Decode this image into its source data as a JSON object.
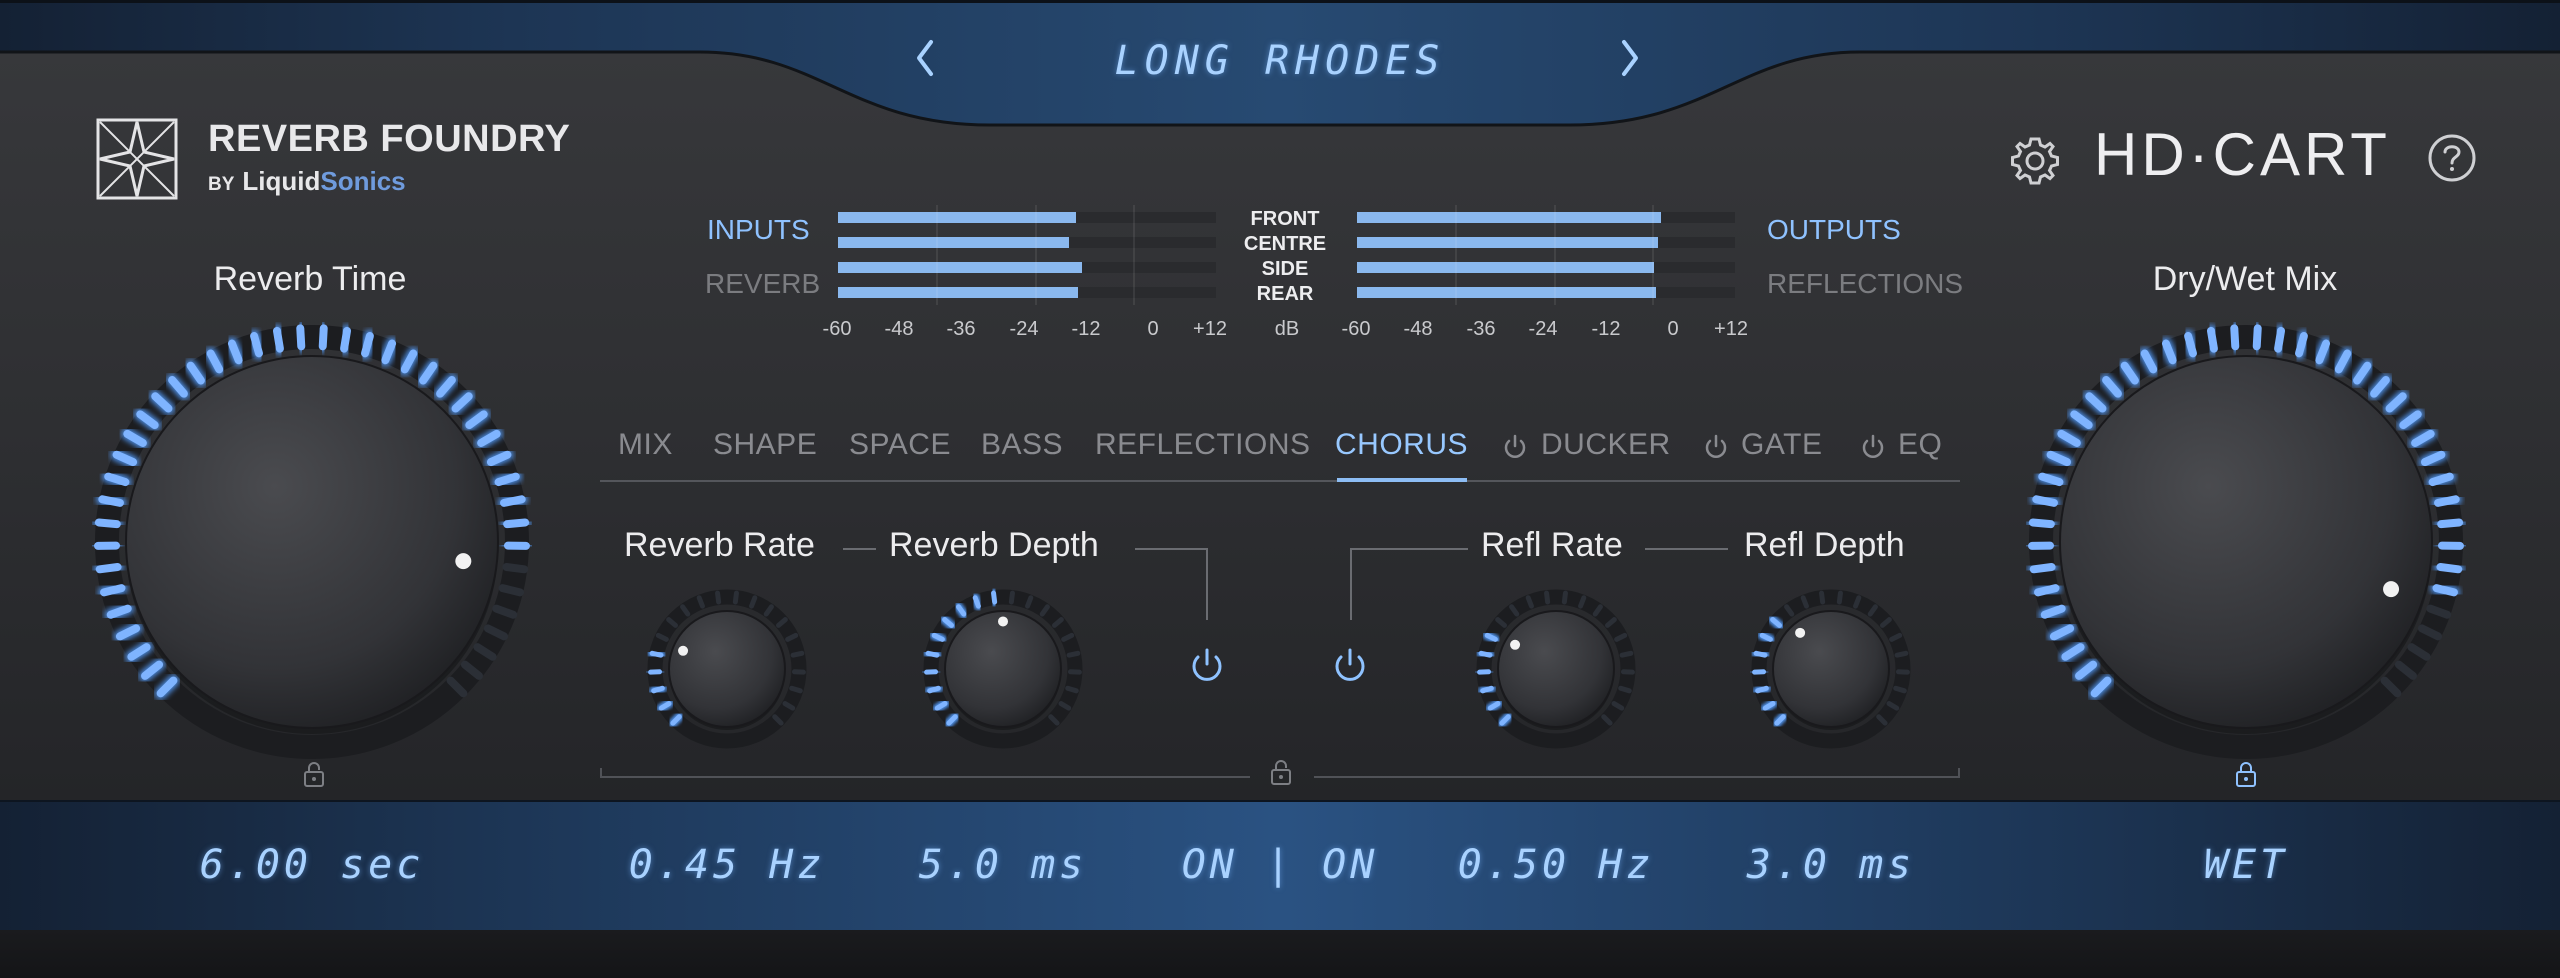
{
  "preset": {
    "name": "LONG RHODES"
  },
  "brand": {
    "title": "REVERB FOUNDRY",
    "by": "BY",
    "liquid": "Liquid",
    "sonics": "Sonics"
  },
  "product": {
    "name": "HD·CART"
  },
  "knobs": {
    "reverb_time": {
      "label": "Reverb Time",
      "value": 0.86
    },
    "dry_wet": {
      "label": "Dry/Wet Mix",
      "value": 0.9
    },
    "reverb_rate": {
      "label": "Reverb Rate",
      "value": 0.25
    },
    "reverb_depth": {
      "label": "Reverb Depth",
      "value": 0.5
    },
    "refl_rate": {
      "label": "Refl Rate",
      "value": 0.28
    },
    "refl_depth": {
      "label": "Refl Depth",
      "value": 0.35
    }
  },
  "meters": {
    "inputs_label": "INPUTS",
    "reverb_label": "REVERB",
    "outputs_label": "OUTPUTS",
    "reflections_label": "REFLECTIONS",
    "channels": [
      "FRONT",
      "CENTRE",
      "SIDE",
      "REAR"
    ],
    "scale": [
      "-60",
      "-48",
      "-36",
      "-24",
      "-12",
      "0",
      "+12"
    ],
    "unit": "dB",
    "input_levels_fraction": [
      0.63,
      0.61,
      0.645,
      0.635
    ],
    "output_levels_fraction": [
      0.805,
      0.795,
      0.785,
      0.79
    ]
  },
  "tabs": [
    "MIX",
    "SHAPE",
    "SPACE",
    "BASS",
    "REFLECTIONS",
    "CHORUS",
    "DUCKER",
    "GATE",
    "EQ"
  ],
  "active_tab": "CHORUS",
  "readouts": {
    "reverb_time": "6.00 sec",
    "reverb_rate": "0.45 Hz",
    "reverb_depth": "5.0 ms",
    "chorus_state": "ON | ON",
    "refl_rate": "0.50 Hz",
    "refl_depth": "3.0 ms",
    "dry_wet": "WET"
  },
  "colors": {
    "accent": "#8ab8ee",
    "led": "#7fb4ff",
    "led_dim": "#2b2f36"
  }
}
